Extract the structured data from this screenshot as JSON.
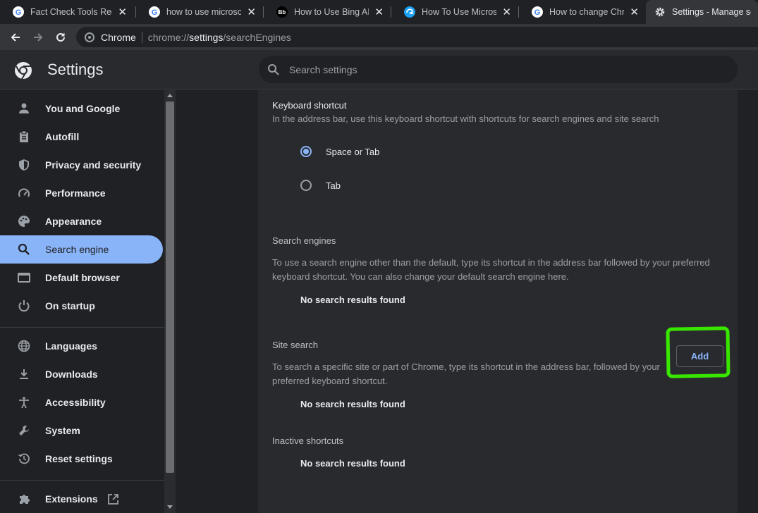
{
  "browser": {
    "tabs": [
      {
        "title": "Fact Check Tools Rece",
        "favicon": "google-icon"
      },
      {
        "title": "how to use microsoft I",
        "favicon": "google-icon"
      },
      {
        "title": "How to Use Bing AI In",
        "favicon": "bb-icon",
        "favicon_text": "Bb"
      },
      {
        "title": "How To Use Microsoft",
        "favicon": "edge-icon"
      },
      {
        "title": "How to change Chrom",
        "favicon": "google-icon"
      },
      {
        "title": "Settings - Manage sea",
        "favicon": "gear-icon",
        "active": true
      }
    ],
    "omnibox": {
      "site_label": "Chrome",
      "url_prefix": "chrome://",
      "url_host": "settings",
      "url_path": "/searchEngines"
    }
  },
  "header": {
    "title": "Settings",
    "search_placeholder": "Search settings"
  },
  "sidebar": {
    "items": [
      {
        "label": "You and Google",
        "icon": "person-icon"
      },
      {
        "label": "Autofill",
        "icon": "clipboard-icon"
      },
      {
        "label": "Privacy and security",
        "icon": "shield-icon"
      },
      {
        "label": "Performance",
        "icon": "speedometer-icon"
      },
      {
        "label": "Appearance",
        "icon": "palette-icon"
      },
      {
        "label": "Search engine",
        "icon": "search-icon",
        "selected": true
      },
      {
        "label": "Default browser",
        "icon": "browser-icon"
      },
      {
        "label": "On startup",
        "icon": "power-icon"
      },
      {
        "label": "Languages",
        "icon": "globe-icon"
      },
      {
        "label": "Downloads",
        "icon": "download-icon"
      },
      {
        "label": "Accessibility",
        "icon": "accessibility-icon"
      },
      {
        "label": "System",
        "icon": "wrench-icon"
      },
      {
        "label": "Reset settings",
        "icon": "history-icon"
      },
      {
        "label": "Extensions",
        "icon": "puzzle-icon"
      }
    ]
  },
  "main": {
    "keyboard_shortcut": {
      "title": "Keyboard shortcut",
      "description": "In the address bar, use this keyboard shortcut with shortcuts for search engines and site search",
      "options": [
        {
          "label": "Space or Tab",
          "checked": true
        },
        {
          "label": "Tab",
          "checked": false
        }
      ]
    },
    "search_engines": {
      "title": "Search engines",
      "description": "To use a search engine other than the default, type its shortcut in the address bar followed by your preferred keyboard shortcut. You can also change your default search engine here.",
      "empty": "No search results found"
    },
    "site_search": {
      "title": "Site search",
      "description": "To search a specific site or part of Chrome, type its shortcut in the address bar, followed by your preferred keyboard shortcut.",
      "empty": "No search results found",
      "add_label": "Add"
    },
    "inactive_shortcuts": {
      "title": "Inactive shortcuts",
      "empty": "No search results found"
    }
  },
  "colors": {
    "accent": "#8ab4f8",
    "highlight": "#39e600",
    "background": "#202124",
    "card": "#292a2d"
  }
}
